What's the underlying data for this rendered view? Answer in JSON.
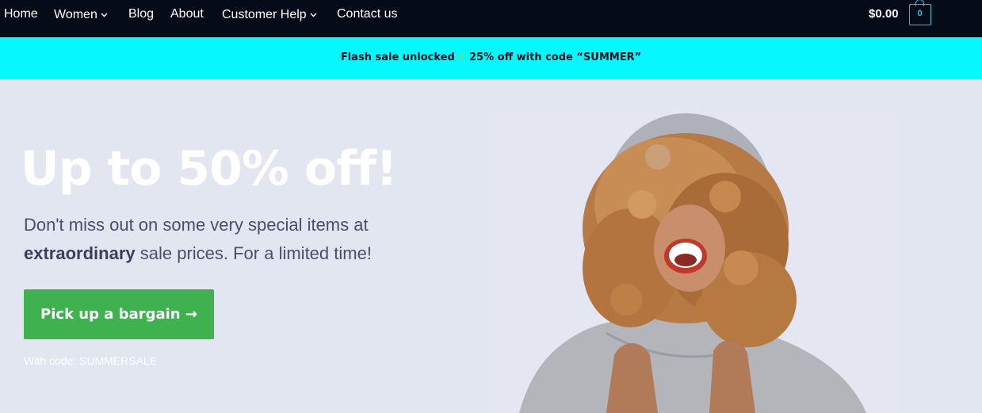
{
  "nav": {
    "items": [
      {
        "label": "Home",
        "dropdown": false
      },
      {
        "label": "Women",
        "dropdown": true
      },
      {
        "label": "Blog",
        "dropdown": false
      },
      {
        "label": "About",
        "dropdown": false
      },
      {
        "label": "Customer Help",
        "dropdown": true
      },
      {
        "label": "Contact us",
        "dropdown": false
      }
    ],
    "chevron": "⌄",
    "cart_total": "$0.00",
    "cart_count": "0",
    "cart_icon": "shopping-bag-icon"
  },
  "promo": {
    "text_before": "Flash sale unlocked ",
    "bolt": "⚡",
    "text_after": " 25% off with code “SUMMER”"
  },
  "hero": {
    "headline": "Up to 50% off!",
    "sub_part1": "Don't miss out on some very special items at ",
    "sub_bold": "extraordinary",
    "sub_part2": " sale prices. For a limited time!",
    "cta_label": "Pick up a bargain →",
    "code_note": "With code: SUMMERSALE"
  },
  "colors": {
    "nav_bg": "#060b1a",
    "promo_bg": "#06f7fe",
    "hero_bg": "#e2e6f0",
    "cta_bg": "#3fb24f",
    "cart_accent": "#17c8cf"
  }
}
